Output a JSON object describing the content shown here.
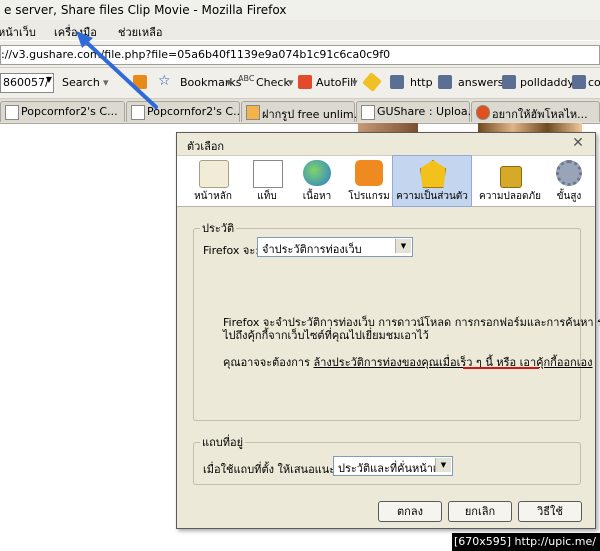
{
  "window_title": "e server, Share files Clip Movie - Mozilla Firefox",
  "menu": [
    "หน้าเว็บ",
    "เครื่องมือ",
    "ช่วยเหลือ"
  ],
  "url": "://v3.gushare.com/file.php?file=05a6b40f1139e9a074b1c91c6ca0c9f0",
  "toolbar": {
    "field": "860057/",
    "search": "Search",
    "bookmarks": "Bookmarks",
    "check": "Check",
    "autofill": "AutoFill",
    "http": "http",
    "answers": "answers",
    "polldaddy": "polldaddy",
    "trail": "co"
  },
  "tabs": [
    "Popcornfor2's C...",
    "Popcornfor2's C...",
    "ฝากรูป free unlim...",
    "GUShare : Uploa...",
    "อยากให้ฮัพโหลไห..."
  ],
  "dialog": {
    "title": "ตัวเลือก",
    "panels": [
      "หน้าหลัก",
      "แท็บ",
      "เนื้อหา",
      "โปรแกรม",
      "ความเป็นส่วนตัว",
      "ความปลอดภัย",
      "ขั้นสูง"
    ],
    "history": {
      "legend": "ประวัติ",
      "label": "Firefox จะ:",
      "select": "จำประวัติการท่องเว็บ",
      "desc1": "Firefox จะจำประวัติการท่องเว็บ การดาวน์โหลด การกรอกฟอร์มและการค้นหา รวม",
      "desc2": "ไปถึงคุ้กกี้จากเว็บไซต์ที่คุณไปเยี่ยมชมเอาไว้",
      "hint_prefix": "คุณอาจจะต้องการ",
      "hint_link1": "ล้างประวัติการท่องของคุณเมื่อเร็ว ๆ นี้",
      "hint_mid": "หรือ",
      "hint_link2": "เอาคุ้กกี้ออกเอง"
    },
    "locationbar": {
      "legend": "แถบที่อยู่",
      "label": "เมื่อใช้แถบที่ตั้ง ให้เสนอแนะ :",
      "select": "ประวัติและที่คั่นหน้าเว็บ"
    },
    "buttons": {
      "ok": "ตกลง",
      "cancel": "ยกเลิก",
      "help": "วิธีใช้"
    }
  },
  "footer": "[670x595] http://upic.me/",
  "colors": {
    "accent_arrow": "#2f6ad9",
    "underline": "#d81414",
    "selected_panel": "#c4d5ef"
  }
}
